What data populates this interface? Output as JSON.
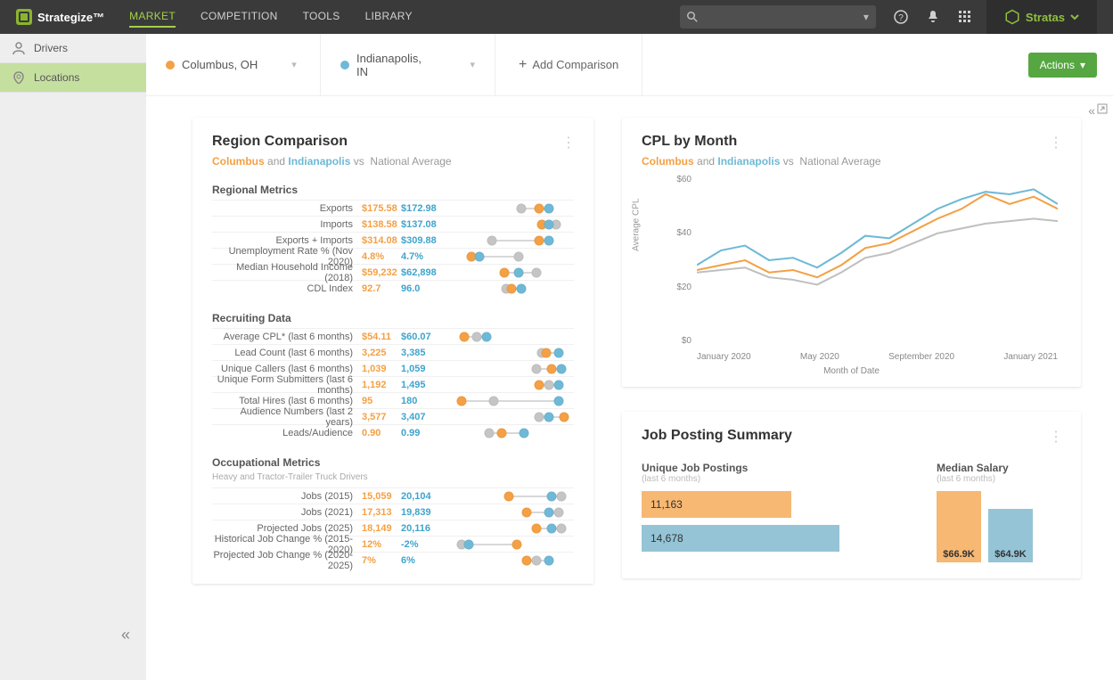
{
  "brand": "Strategize™",
  "nav": [
    "MARKET",
    "COMPETITION",
    "TOOLS",
    "LIBRARY"
  ],
  "nav_active": 0,
  "top_right": "Stratas",
  "sidebar": [
    {
      "label": "Drivers",
      "active": false
    },
    {
      "label": "Locations",
      "active": true
    }
  ],
  "compare": {
    "a": "Columbus, OH",
    "b": "Indianapolis, IN",
    "add": "Add Comparison",
    "actions": "Actions"
  },
  "region_card": {
    "title": "Region Comparison",
    "sub_a": "Columbus",
    "sub_and": "and",
    "sub_b": "Indianapolis",
    "sub_vs": "vs",
    "sub_nat": "National Average",
    "sections": [
      {
        "title": "Regional Metrics",
        "subtitle": "",
        "rows": [
          {
            "label": "Exports",
            "o": "$175.58",
            "b": "$172.98",
            "po": 72,
            "pb": 80,
            "pg": 58
          },
          {
            "label": "Imports",
            "o": "$138.58",
            "b": "$137.08",
            "po": 74,
            "pb": 80,
            "pg": 86
          },
          {
            "label": "Exports + Imports",
            "o": "$314.08",
            "b": "$309.88",
            "po": 72,
            "pb": 80,
            "pg": 34
          },
          {
            "label": "Unemployment Rate % (Nov 2020)",
            "o": "4.8%",
            "b": "4.7%",
            "po": 18,
            "pb": 24,
            "pg": 56
          },
          {
            "label": "Median Household Income (2018)",
            "o": "$59,232",
            "b": "$62,898",
            "po": 44,
            "pb": 56,
            "pg": 70
          },
          {
            "label": "CDL Index",
            "o": "92.7",
            "b": "96.0",
            "po": 50,
            "pb": 58,
            "pg": 46
          }
        ]
      },
      {
        "title": "Recruiting Data",
        "subtitle": "",
        "rows": [
          {
            "label": "Average CPL* (last 6 months)",
            "o": "$54.11",
            "b": "$60.07",
            "po": 12,
            "pb": 30,
            "pg": 22
          },
          {
            "label": "Lead Count (last 6 months)",
            "o": "3,225",
            "b": "3,385",
            "po": 78,
            "pb": 88,
            "pg": 74
          },
          {
            "label": "Unique Callers (last 6 months)",
            "o": "1,039",
            "b": "1,059",
            "po": 82,
            "pb": 90,
            "pg": 70
          },
          {
            "label": "Unique Form Submitters (last 6 months)",
            "o": "1,192",
            "b": "1,495",
            "po": 72,
            "pb": 88,
            "pg": 80
          },
          {
            "label": "Total Hires (last 6 months)",
            "o": "95",
            "b": "180",
            "po": 10,
            "pb": 88,
            "pg": 36
          },
          {
            "label": "Audience Numbers (last 2 years)",
            "o": "3,577",
            "b": "3,407",
            "po": 92,
            "pb": 80,
            "pg": 72
          },
          {
            "label": "Leads/Audience",
            "o": "0.90",
            "b": "0.99",
            "po": 42,
            "pb": 60,
            "pg": 32
          }
        ]
      },
      {
        "title": "Occupational Metrics",
        "subtitle": "Heavy and Tractor-Trailer Truck Drivers",
        "rows": [
          {
            "label": "Jobs (2015)",
            "o": "15,059",
            "b": "20,104",
            "po": 48,
            "pb": 82,
            "pg": 90
          },
          {
            "label": "Jobs (2021)",
            "o": "17,313",
            "b": "19,839",
            "po": 62,
            "pb": 80,
            "pg": 88
          },
          {
            "label": "Projected Jobs (2025)",
            "o": "18,149",
            "b": "20,116",
            "po": 70,
            "pb": 82,
            "pg": 90
          },
          {
            "label": "Historical Job Change % (2015-2020)",
            "o": "12%",
            "b": "-2%",
            "po": 54,
            "pb": 16,
            "pg": 10
          },
          {
            "label": "Projected Job Change % (2020-2025)",
            "o": "7%",
            "b": "6%",
            "po": 62,
            "pb": 80,
            "pg": 70
          }
        ]
      }
    ]
  },
  "cpl_card": {
    "title": "CPL by Month",
    "sub_a": "Columbus",
    "sub_and": "and",
    "sub_b": "Indianapolis",
    "sub_vs": "vs",
    "sub_nat": "National Average",
    "ylabel": "Average CPL",
    "xlabel": "Month of Date"
  },
  "chart_data": {
    "type": "line",
    "xlabel": "Month of Date",
    "ylabel": "Average CPL",
    "ylim": [
      0,
      70
    ],
    "yticks": [
      0,
      20,
      40,
      60
    ],
    "xticks": [
      "January 2020",
      "May 2020",
      "September 2020",
      "January 2021"
    ],
    "x": [
      "Nov 2019",
      "Dec 2019",
      "Jan 2020",
      "Feb 2020",
      "Mar 2020",
      "Apr 2020",
      "May 2020",
      "Jun 2020",
      "Jul 2020",
      "Aug 2020",
      "Sep 2020",
      "Oct 2020",
      "Nov 2020",
      "Dec 2020",
      "Jan 2021",
      "Feb 2021"
    ],
    "series": [
      {
        "name": "Indianapolis",
        "color": "#6fb9d6",
        "values": [
          33,
          39,
          41,
          35,
          36,
          32,
          38,
          45,
          44,
          50,
          56,
          60,
          63,
          62,
          64,
          58
        ]
      },
      {
        "name": "Columbus",
        "color": "#f4a045",
        "values": [
          31,
          33,
          35,
          30,
          31,
          28,
          33,
          40,
          42,
          47,
          52,
          56,
          62,
          58,
          61,
          56
        ]
      },
      {
        "name": "National Average",
        "color": "#bfbfbf",
        "values": [
          30,
          31,
          32,
          28,
          27,
          25,
          30,
          36,
          38,
          42,
          46,
          48,
          50,
          51,
          52,
          51
        ]
      }
    ]
  },
  "job_card": {
    "title": "Job Posting Summary",
    "unique": {
      "title": "Unique Job Postings",
      "note": "(last 6 months)",
      "a": "11,163",
      "b": "14,678",
      "wa": 62,
      "wb": 82
    },
    "salary": {
      "title": "Median Salary",
      "note": "(last 6 months)",
      "a": "$66.9K",
      "b": "$64.9K",
      "ha": 80,
      "hb": 60
    }
  }
}
